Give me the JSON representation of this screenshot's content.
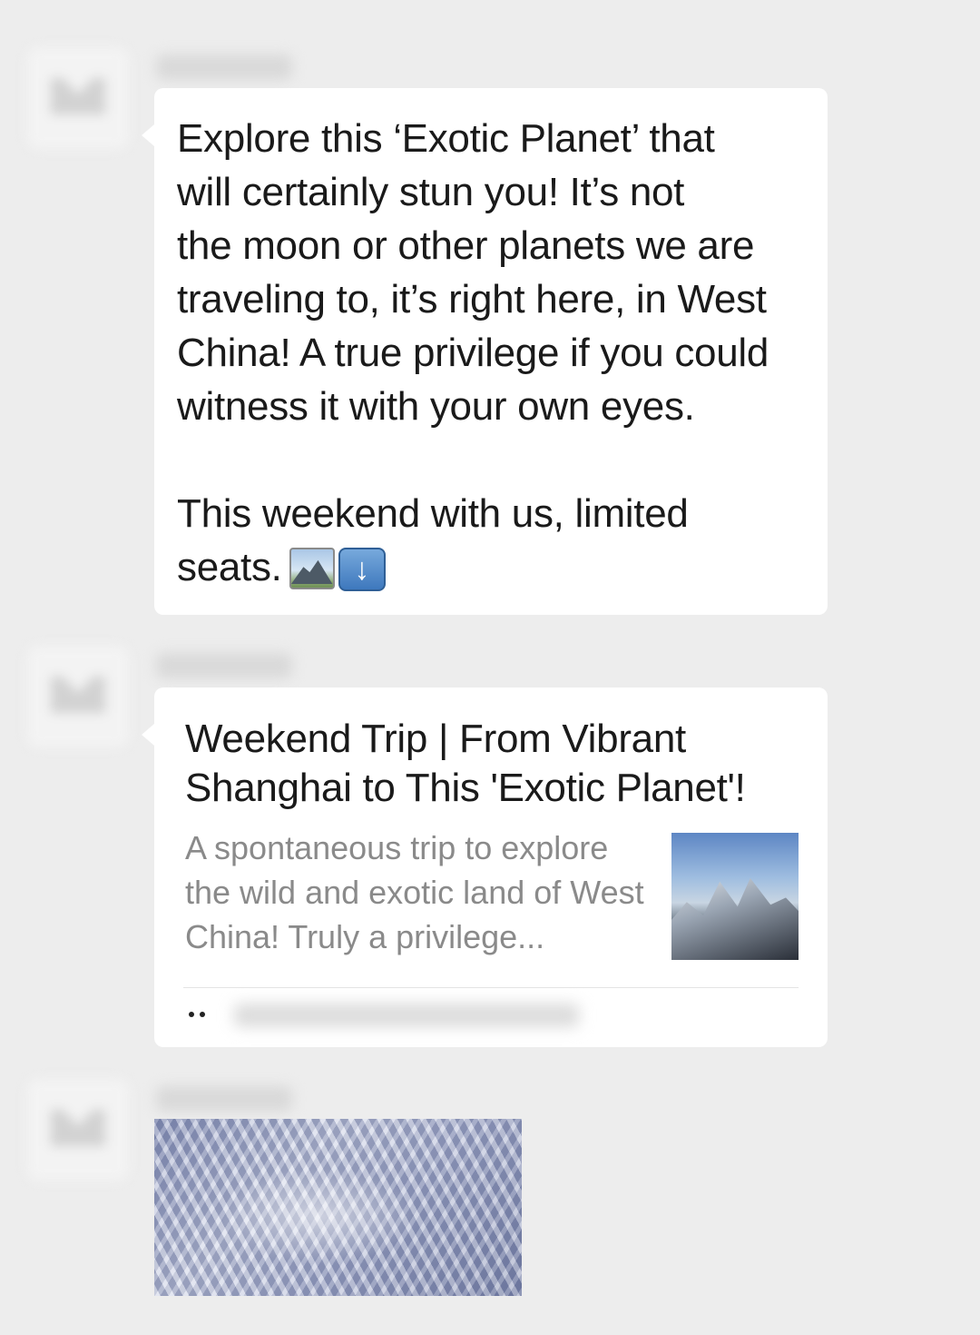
{
  "messages": [
    {
      "type": "text",
      "lines": [
        "Explore this ‘Exotic Planet’ that",
        "will certainly stun you! It’s not",
        "the moon or other planets we are",
        "traveling to, it’s right here, in West",
        "China! A true privilege if you could",
        "witness it with your own eyes."
      ],
      "line7": "This weekend with us, limited",
      "line8": "seats.",
      "emojis": [
        "mountain-emoji-icon",
        "down-arrow-emoji-icon"
      ]
    },
    {
      "type": "link",
      "title": "Weekend Trip | From Vibrant Shanghai to This 'Exotic Planet'!",
      "description": "A spontaneous trip to explore the wild and exotic land of West China! Truly a privilege...",
      "source_icon": "panda-icon"
    },
    {
      "type": "image"
    }
  ],
  "colors": {
    "background": "#ededed",
    "bubble": "#ffffff",
    "text": "#1a1a1a",
    "secondary_text": "#8a8a8a",
    "arrow_emoji": "#3e78bd"
  }
}
